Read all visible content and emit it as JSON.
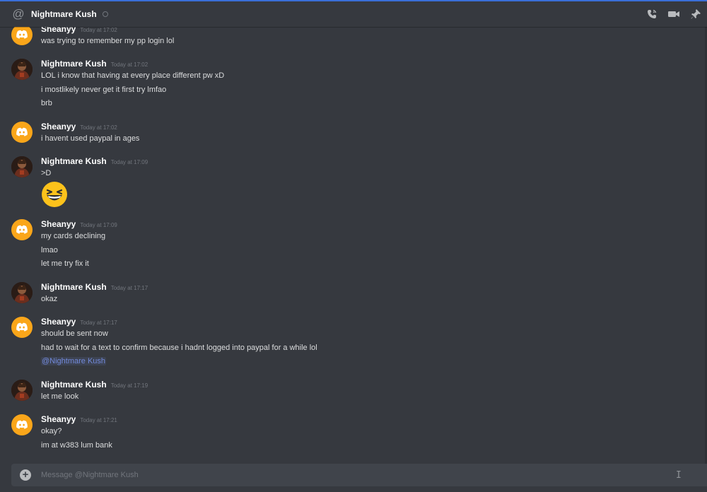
{
  "header": {
    "channel_name": "Nightmare Kush",
    "icons": [
      "at-icon",
      "status-icon",
      "call-icon",
      "video-icon",
      "pin-icon"
    ]
  },
  "messages": [
    {
      "author": "Sheanyy",
      "avatar": "discord-logo-avatar",
      "time": "Today at 17:02",
      "lines": [
        "was trying to remember my pp login lol"
      ]
    },
    {
      "author": "Nightmare Kush",
      "avatar": "user-photo-avatar",
      "time": "Today at 17:02",
      "lines": [
        "LOL i know that having at every place different pw xD",
        "i mostlikely never get it first try lmfao",
        "brb"
      ]
    },
    {
      "author": "Sheanyy",
      "avatar": "discord-logo-avatar",
      "time": "Today at 17:02",
      "lines": [
        "i havent used paypal in ages"
      ]
    },
    {
      "author": "Nightmare Kush",
      "avatar": "user-photo-avatar",
      "time": "Today at 17:09",
      "lines": [
        ">D"
      ],
      "emoji": "grinning-squinting-face"
    },
    {
      "author": "Sheanyy",
      "avatar": "discord-logo-avatar",
      "time": "Today at 17:09",
      "lines": [
        "my cards declining",
        "lmao",
        "let me try fix it"
      ]
    },
    {
      "author": "Nightmare Kush",
      "avatar": "user-photo-avatar",
      "time": "Today at 17:17",
      "lines": [
        "okaz"
      ]
    },
    {
      "author": "Sheanyy",
      "avatar": "discord-logo-avatar",
      "time": "Today at 17:17",
      "lines": [
        "should be sent now",
        "had to wait for a text to confirm because i hadnt logged into paypal for a while lol"
      ],
      "mention": "@Nightmare Kush"
    },
    {
      "author": "Nightmare Kush",
      "avatar": "user-photo-avatar",
      "time": "Today at 17:19",
      "lines": [
        "let me look"
      ]
    },
    {
      "author": "Sheanyy",
      "avatar": "discord-logo-avatar",
      "time": "Today at 17:21",
      "lines": [
        "okay?",
        "im at w383 lum bank"
      ]
    }
  ],
  "composer": {
    "placeholder": "Message @Nightmare Kush",
    "value": ""
  },
  "colors": {
    "background": "#36393f",
    "composer": "#40444b",
    "sheanyy_avatar": "#faa61a",
    "mention": "#7289da"
  }
}
